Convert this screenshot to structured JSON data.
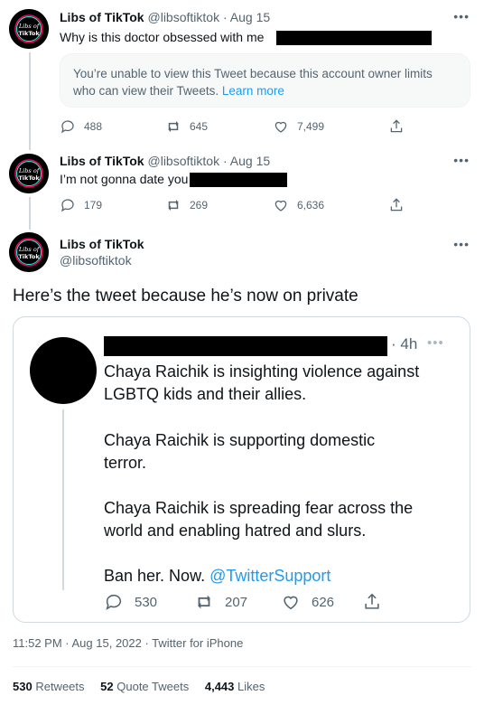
{
  "tweets": [
    {
      "name": "Libs of TikTok",
      "handle": "@libsoftiktok",
      "date": "Aug 15",
      "text": "Why is this doctor obsessed with me",
      "notice": "You’re unable to view this Tweet because this account owner limits who can view their Tweets.",
      "notice_link": "Learn more",
      "replies": "488",
      "retweets": "645",
      "likes": "7,499"
    },
    {
      "name": "Libs of TikTok",
      "handle": "@libsoftiktok",
      "date": "Aug 15",
      "text": "I’m not gonna date you",
      "replies": "179",
      "retweets": "269",
      "likes": "6,636"
    }
  ],
  "main": {
    "name": "Libs of TikTok",
    "handle": "@libsoftiktok",
    "text": "Here’s the tweet because he’s now on private",
    "quote": {
      "time": "· 4h",
      "para1": [
        "Chaya Raichik is insighting violence against",
        "LGBTQ kids and their allies."
      ],
      "para2": [
        "Chaya Raichik is supporting domestic",
        "terror."
      ],
      "para3": [
        "Chaya Raichik is spreading fear across the",
        "world and enabling hatred and slurs."
      ],
      "para4_text": "Ban her. Now.",
      "para4_mention": "@TwitterSupport",
      "replies": "530",
      "retweets": "207",
      "likes": "626"
    },
    "timestamp": "11:52 PM · Aug 15, 2022 · Twitter for iPhone",
    "stats": {
      "retweets_count": "530",
      "retweets_label": "Retweets",
      "quotes_count": "52",
      "quotes_label": "Quote Tweets",
      "likes_count": "4,443",
      "likes_label": "Likes"
    }
  },
  "avatar_text": [
    "Libs of",
    "TikTok"
  ],
  "colors": {
    "accent": "#1d9bf0",
    "muted": "#536471",
    "border": "#cfd9de"
  },
  "icons": [
    "reply-icon",
    "retweet-icon",
    "like-icon",
    "share-icon",
    "more-icon"
  ]
}
